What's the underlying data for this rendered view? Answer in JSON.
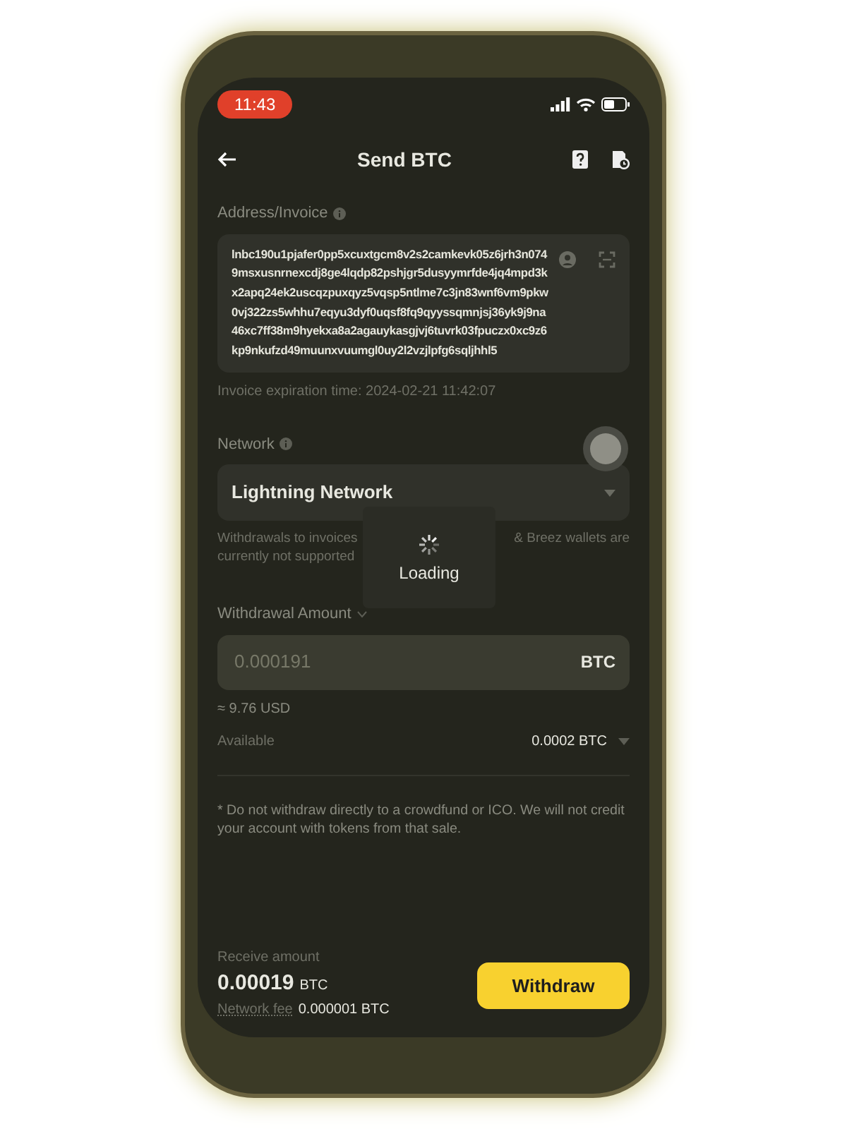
{
  "status_bar": {
    "time": "11:43"
  },
  "header": {
    "title": "Send BTC"
  },
  "address": {
    "label": "Address/Invoice",
    "value": "lnbc190u1pjafer0pp5xcuxtgcm8v2s2camkevk05z6jrh3n0749msxusnrnexcdj8ge4lqdp82pshjgr5dusyymrfde4jq4mpd3kx2apq24ek2uscqzpuxqyz5vqsp5ntlme7c3jn83wnf6vm9pkw0vj322zs5whhu7eqyu3dyf0uqsf8fq9qyyssqmnjsj36yk9j9na46xc7ff38m9hyekxa8a2agauykasgjvj6tuvrk03fpuczx0xc9z6kp9nkufzd49muunxvuumgl0uy2l2vzjlpfg6sqljhhl5",
    "expiration": "Invoice expiration time: 2024-02-21 11:42:07"
  },
  "network": {
    "label": "Network",
    "value": "Lightning Network",
    "note_parts": [
      "Withdrawals to invoices",
      "& Breez wallets are",
      "currently not supported"
    ]
  },
  "loading": {
    "label": "Loading"
  },
  "amount": {
    "label": "Withdrawal Amount",
    "placeholder": "0.000191",
    "unit": "BTC",
    "usd": "≈ 9.76 USD",
    "available_label": "Available",
    "available_value": "0.0002 BTC"
  },
  "warning": "* Do not withdraw directly to a crowdfund or ICO. We will not credit your account with tokens from that sale.",
  "footer": {
    "receive_label": "Receive amount",
    "receive_value": "0.00019",
    "receive_unit": "BTC",
    "fee_label": "Network fee",
    "fee_value": "0.000001 BTC",
    "button": "Withdraw"
  }
}
